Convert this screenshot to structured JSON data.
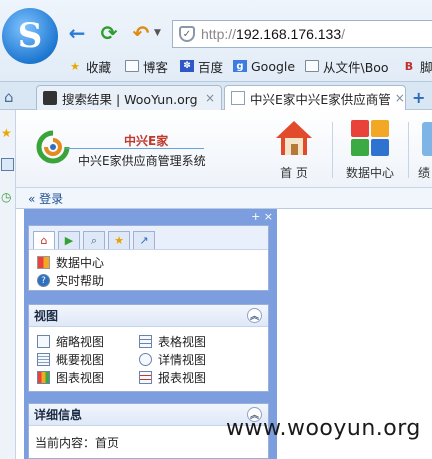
{
  "browser": {
    "address": {
      "protocol": "http://",
      "host": "192.168.176.133",
      "path": "/"
    },
    "bookmarks": [
      {
        "icon": "star-icon",
        "label": "收藏"
      },
      {
        "icon": "folder-icon",
        "label": "博客"
      },
      {
        "icon": "paw-icon",
        "label": "百度"
      },
      {
        "icon": "google-icon",
        "label": "Google"
      },
      {
        "icon": "folder-icon",
        "label": "从文件\\Boo"
      },
      {
        "icon": "brand-b-icon",
        "label": "脚"
      }
    ],
    "tabs": [
      {
        "label": "搜索结果 | WooYun.org",
        "close": "×"
      },
      {
        "label": "中兴E家中兴E家供应商管",
        "close": "×"
      }
    ],
    "newtab": "+"
  },
  "app": {
    "brand_top": "中兴E家",
    "brand_sub": "中兴E家供应商管理系统",
    "nav": [
      {
        "label": "首 页",
        "icon": "house-icon"
      },
      {
        "label": "数据中心",
        "icon": "grid-icon"
      },
      {
        "label": "绩",
        "icon": "bottle-icon"
      }
    ],
    "login": "« 登录"
  },
  "panel": {
    "tools": "+ ×",
    "quick": [
      {
        "label": "数据中心",
        "icon": "grid-color-icon"
      },
      {
        "label": "实时帮助",
        "icon": "help-icon"
      }
    ],
    "view": {
      "title": "视图",
      "items": [
        "缩略视图",
        "表格视图",
        "概要视图",
        "详情视图",
        "图表视图",
        "报表视图"
      ]
    },
    "detail": {
      "title": "详细信息",
      "current": "当前内容：首页"
    }
  },
  "watermark": "www.wooyun.org",
  "colors": {
    "panel": "#7d9ede",
    "accent": "#1f78d1",
    "brand_red": "#c0392b"
  }
}
